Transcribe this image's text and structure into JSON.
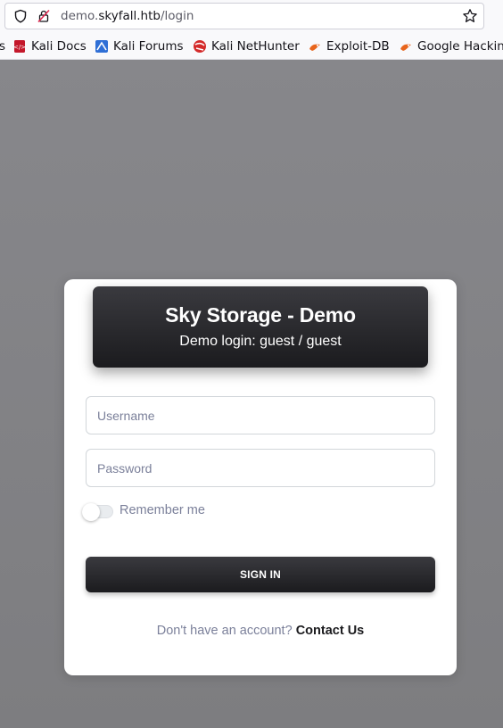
{
  "browser": {
    "url_prefix": "demo.",
    "url_host": "skyfall.htb",
    "url_path": "/login",
    "bookmarks": [
      {
        "label": "s",
        "icon": "partial-bookmark"
      },
      {
        "label": "Kali Docs",
        "icon": "kali-docs-icon"
      },
      {
        "label": "Kali Forums",
        "icon": "kali-forums-icon"
      },
      {
        "label": "Kali NetHunter",
        "icon": "kali-nethunter-icon"
      },
      {
        "label": "Exploit-DB",
        "icon": "exploit-db-icon"
      },
      {
        "label": "Google Hackin",
        "icon": "google-hacking-icon"
      }
    ]
  },
  "login": {
    "title": "Sky Storage - Demo",
    "subtitle": "Demo login: guest / guest",
    "username_placeholder": "Username",
    "password_placeholder": "Password",
    "remember_label": "Remember me",
    "remember_checked": false,
    "signin_label": "SIGN IN",
    "footer_prompt": "Don't have an account?",
    "footer_link": "Contact Us"
  },
  "colors": {
    "page_background": "#828285",
    "header_dark": "#1b1b1e",
    "muted_text": "#7b809a"
  }
}
